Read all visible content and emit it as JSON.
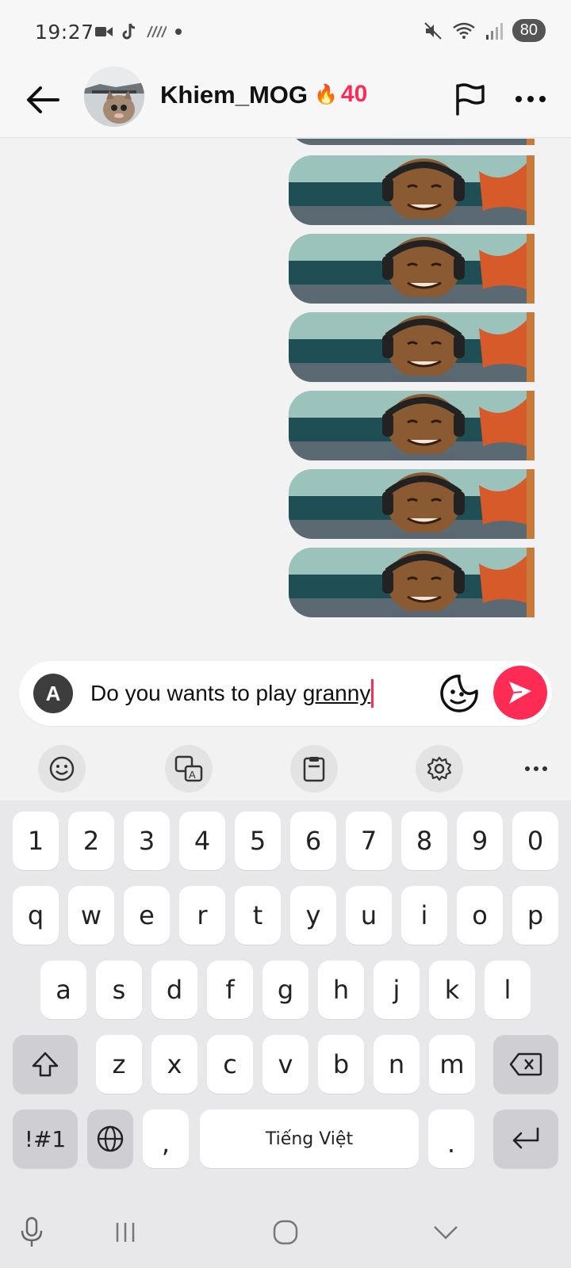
{
  "status_bar": {
    "time": "19:27",
    "battery": "80",
    "icons": [
      "video-camera-icon",
      "tiktok-icon",
      "data-activity-icon",
      "dot-icon",
      "mute-icon",
      "wifi-icon",
      "signal-icon",
      "battery-icon"
    ]
  },
  "header": {
    "username": "Khiem_MOG",
    "streak_emoji": "🔥",
    "streak_count": "40",
    "icons": [
      "back-arrow-icon",
      "flag-icon",
      "more-icon"
    ]
  },
  "chat": {
    "sticker_count": 6
  },
  "input": {
    "kb_button": "A",
    "text_plain": "Do you wants to play ",
    "text_underlined": "granny"
  },
  "keyboard": {
    "toolbar": [
      "emoji-icon",
      "translate-icon",
      "clipboard-icon",
      "settings-icon",
      "more-icon"
    ],
    "row_numbers": [
      "1",
      "2",
      "3",
      "4",
      "5",
      "6",
      "7",
      "8",
      "9",
      "0"
    ],
    "row_1": [
      "q",
      "w",
      "e",
      "r",
      "t",
      "y",
      "u",
      "i",
      "o",
      "p"
    ],
    "row_2": [
      "a",
      "s",
      "d",
      "f",
      "g",
      "h",
      "j",
      "k",
      "l"
    ],
    "row_3": [
      "z",
      "x",
      "c",
      "v",
      "b",
      "n",
      "m"
    ],
    "symbols_key": "!#1",
    "comma_key": ",",
    "space_label": "Tiếng Việt",
    "period_key": "."
  },
  "colors": {
    "accent": "#fe2c55",
    "background": "#f2f2f2"
  }
}
